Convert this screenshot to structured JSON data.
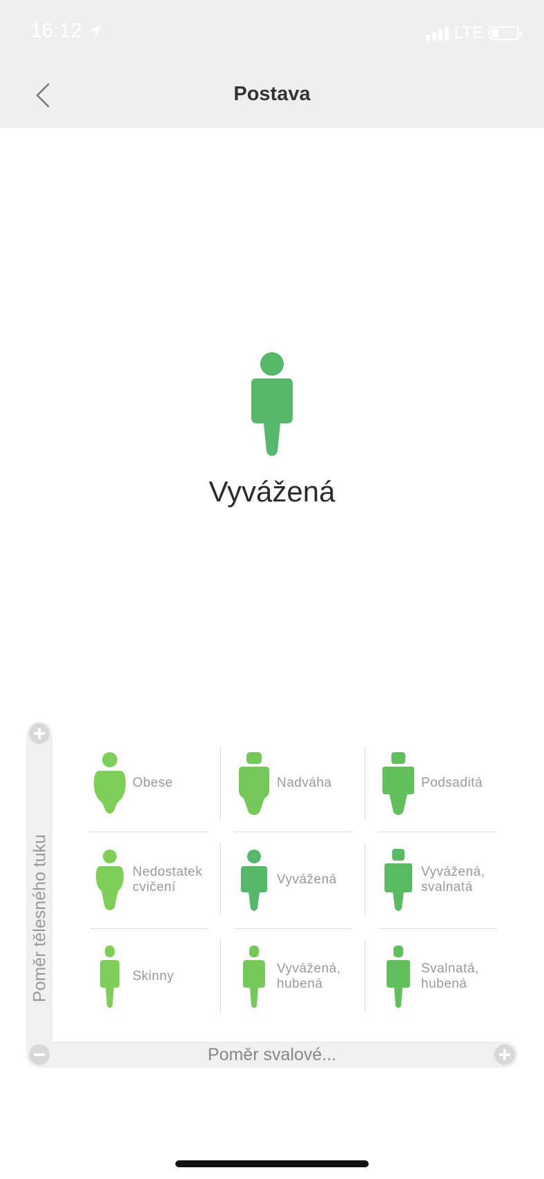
{
  "status_bar": {
    "time": "16:12",
    "network": "LTE"
  },
  "header": {
    "title": "Postava"
  },
  "current": {
    "label": "Vyvážená"
  },
  "axes": {
    "vertical_label": "Poměr tělesného tuku",
    "horizontal_label": "Poměr svalové..."
  },
  "grid": [
    {
      "label": "Obese",
      "color": "#7ecf58"
    },
    {
      "label": "Nadváha",
      "color": "#74c95a"
    },
    {
      "label": "Podsaditá",
      "color": "#62c05c"
    },
    {
      "label": "Nedostatek cvičení",
      "color": "#7ecf58"
    },
    {
      "label": "Vyvážená",
      "color": "#55b86a"
    },
    {
      "label": "Vyvážená, svalnatá",
      "color": "#58bb62"
    },
    {
      "label": "Skinny",
      "color": "#7ecf58"
    },
    {
      "label": "Vyvážená, hubená",
      "color": "#74c95a"
    },
    {
      "label": "Svalnatá, hubená",
      "color": "#62c05c"
    }
  ],
  "colors": {
    "accent": "#55b86a",
    "header_bg": "#efefef"
  },
  "icons": [
    "location-arrow-icon",
    "signal-icon",
    "battery-icon",
    "back-chevron-icon",
    "plus-icon",
    "minus-icon",
    "figure-icon"
  ]
}
